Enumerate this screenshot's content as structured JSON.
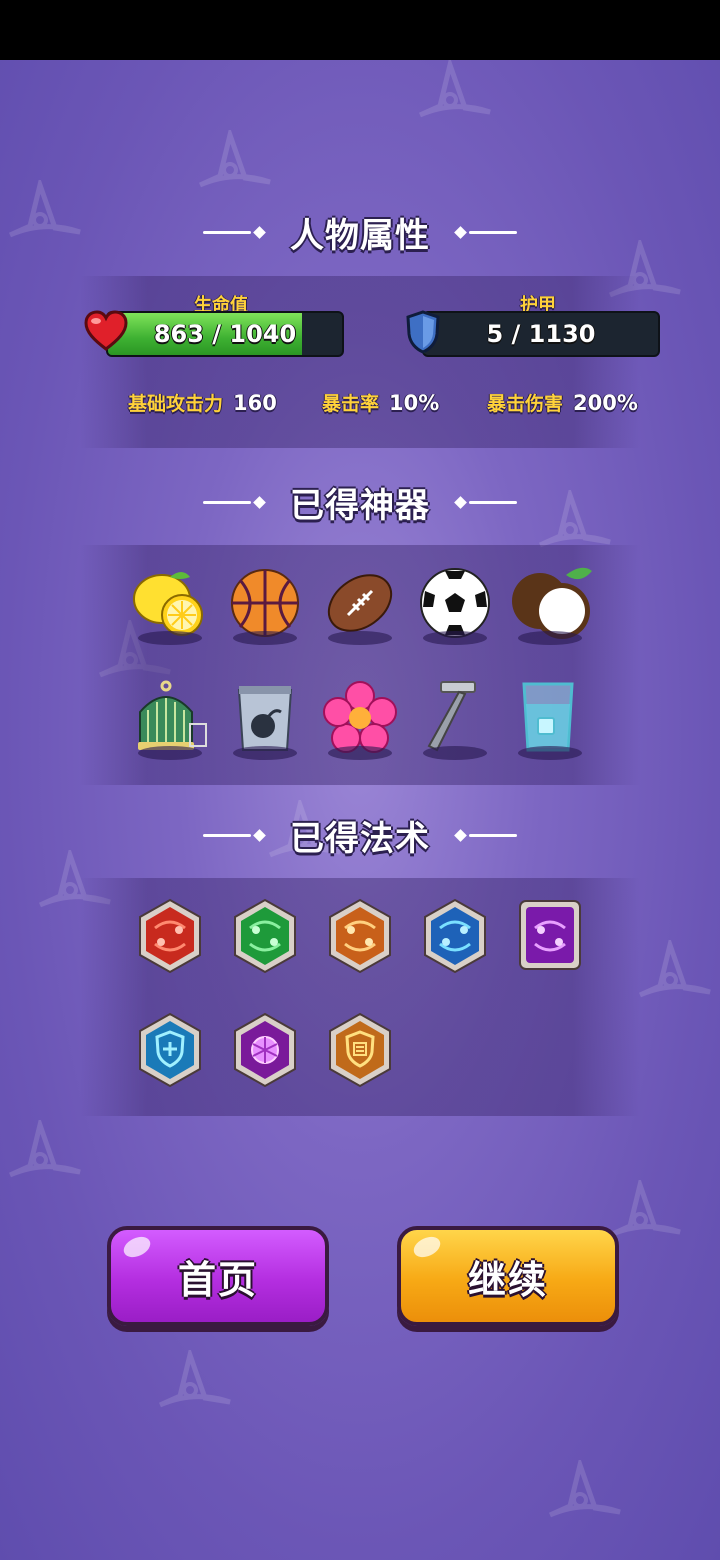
{
  "sections": {
    "attributes_title": "人物属性",
    "artifacts_title": "已得神器",
    "spells_title": "已得法术"
  },
  "hp": {
    "label": "生命值",
    "text": "863 / 1040",
    "current": 863,
    "max": 1040
  },
  "armor": {
    "label": "护甲",
    "text": "5 / 1130",
    "current": 5,
    "max": 1130
  },
  "stats": [
    {
      "label": "基础攻击力",
      "value": "160"
    },
    {
      "label": "暴击率",
      "value": "10%"
    },
    {
      "label": "暴击伤害",
      "value": "200%"
    }
  ],
  "artifacts": [
    "lemon-icon",
    "basketball-icon",
    "football-icon",
    "soccer-ball-icon",
    "coconut-icon",
    "birdcage-icon",
    "bomb-bag-icon",
    "pink-flower-icon",
    "razor-icon",
    "ice-water-glass-icon"
  ],
  "spells": [
    "red-spell-icon",
    "green-spell-icon",
    "orange-spell-icon",
    "blue-spell-icon",
    "purple-spell-icon",
    "shield-plus-spell-icon",
    "purple-gem-spell-icon",
    "gold-shield-spell-icon"
  ],
  "buttons": {
    "home": "首页",
    "continue": "继续"
  },
  "colors": {
    "accent_gold": "#ffd23a",
    "hp_green": "#3eb132",
    "home_purple": "#b42ee0",
    "continue_orange": "#f7a915"
  }
}
